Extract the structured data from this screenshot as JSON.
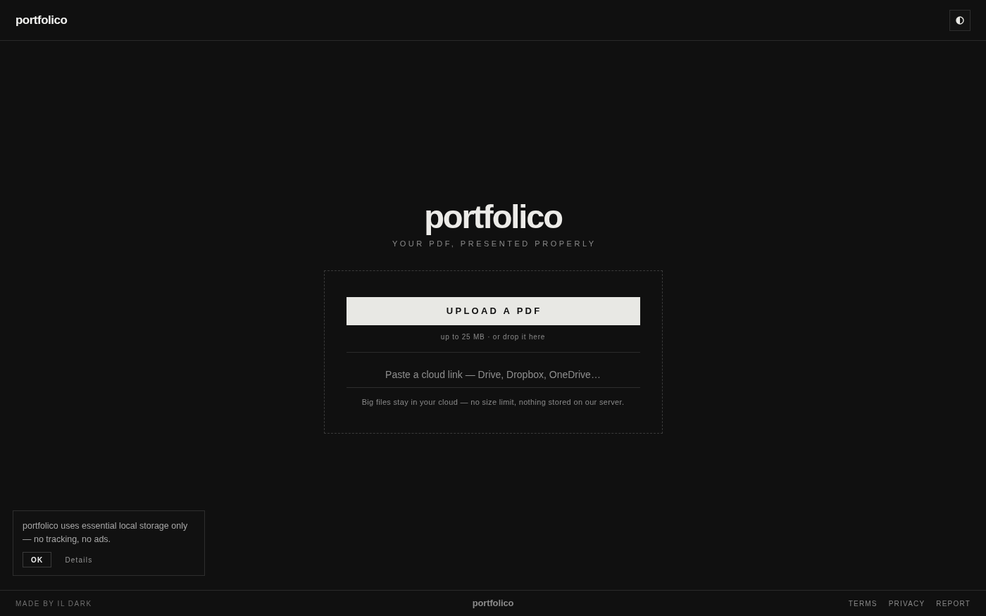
{
  "header": {
    "logo": "portfolico"
  },
  "hero": {
    "title": "portfolico",
    "tagline": "YOUR PDF, PRESENTED PROPERLY"
  },
  "upload": {
    "button": "UPLOAD A PDF",
    "hint": "up to 25 MB · or drop it here",
    "link_field": {
      "placeholder": "Paste a cloud link — Drive, Dropbox, OneDrive…"
    },
    "note": "Big files stay in your cloud — no size limit, nothing stored on our server."
  },
  "cookie_notice": {
    "message": "portfolico uses essential local storage only — no tracking, no ads.",
    "buttons": [
      {
        "label": "OK",
        "kind": "primary"
      },
      {
        "label": "Details",
        "kind": "link"
      }
    ]
  },
  "footer": {
    "credit": "MADE BY IL DARK",
    "logo": "portfolico",
    "links": [
      "TERMS",
      "PRIVACY",
      "REPORT"
    ]
  }
}
